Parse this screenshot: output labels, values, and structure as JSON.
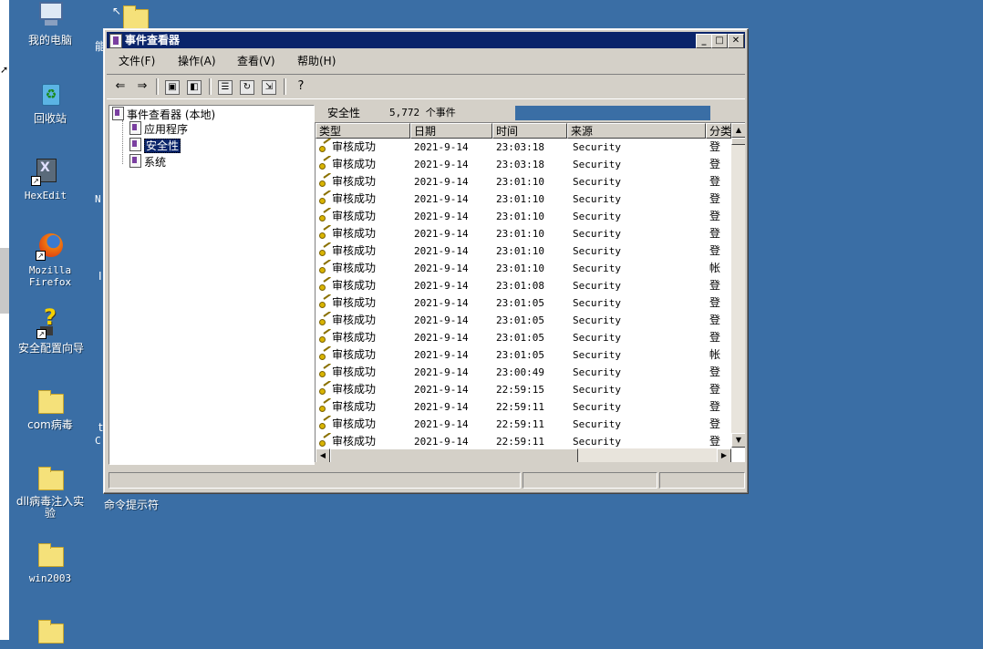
{
  "desktop": {
    "icons": [
      {
        "label": "我的电脑",
        "icon": "my-computer-icon"
      },
      {
        "label": "回收站",
        "icon": "recycle-bin-icon"
      },
      {
        "label": "HexEdit",
        "icon": "hexedit-icon"
      },
      {
        "label": "Mozilla Firefox",
        "icon": "firefox-icon"
      },
      {
        "label": "安全配置向导",
        "icon": "security-wizard-icon"
      },
      {
        "label": "com病毒",
        "icon": "folder-icon"
      },
      {
        "label": "dll病毒注入实验",
        "icon": "folder-icon"
      },
      {
        "label": "win2003",
        "icon": "folder-icon"
      },
      {
        "label": "命令提示符",
        "icon": "cmd-icon"
      }
    ],
    "partial_labels": {
      "a": "能",
      "b": "N",
      "c": "I",
      "d": "t",
      "e": "C"
    }
  },
  "window": {
    "title": "事件查看器",
    "menu": [
      "文件(F)",
      "操作(A)",
      "查看(V)",
      "帮助(H)"
    ],
    "toolbar_icons": [
      "back-arrow-icon",
      "forward-arrow-icon",
      "up-folder-icon",
      "show-hide-tree-icon",
      "properties-icon",
      "refresh-icon",
      "export-list-icon",
      "help-icon"
    ],
    "tree": {
      "root": "事件查看器 (本地)",
      "children": [
        "应用程序",
        "安全性",
        "系统"
      ],
      "selected": "安全性"
    },
    "list": {
      "pane_title": "安全性",
      "event_count": "5,772 个事件",
      "columns": [
        "类型",
        "日期",
        "时间",
        "来源",
        "分类"
      ],
      "rows": [
        {
          "type": "审核成功",
          "date": "2021-9-14",
          "time": "23:03:18",
          "source": "Security",
          "category": "登"
        },
        {
          "type": "审核成功",
          "date": "2021-9-14",
          "time": "23:03:18",
          "source": "Security",
          "category": "登"
        },
        {
          "type": "审核成功",
          "date": "2021-9-14",
          "time": "23:01:10",
          "source": "Security",
          "category": "登"
        },
        {
          "type": "审核成功",
          "date": "2021-9-14",
          "time": "23:01:10",
          "source": "Security",
          "category": "登"
        },
        {
          "type": "审核成功",
          "date": "2021-9-14",
          "time": "23:01:10",
          "source": "Security",
          "category": "登"
        },
        {
          "type": "审核成功",
          "date": "2021-9-14",
          "time": "23:01:10",
          "source": "Security",
          "category": "登"
        },
        {
          "type": "审核成功",
          "date": "2021-9-14",
          "time": "23:01:10",
          "source": "Security",
          "category": "登"
        },
        {
          "type": "审核成功",
          "date": "2021-9-14",
          "time": "23:01:10",
          "source": "Security",
          "category": "帐"
        },
        {
          "type": "审核成功",
          "date": "2021-9-14",
          "time": "23:01:08",
          "source": "Security",
          "category": "登"
        },
        {
          "type": "审核成功",
          "date": "2021-9-14",
          "time": "23:01:05",
          "source": "Security",
          "category": "登"
        },
        {
          "type": "审核成功",
          "date": "2021-9-14",
          "time": "23:01:05",
          "source": "Security",
          "category": "登"
        },
        {
          "type": "审核成功",
          "date": "2021-9-14",
          "time": "23:01:05",
          "source": "Security",
          "category": "登"
        },
        {
          "type": "审核成功",
          "date": "2021-9-14",
          "time": "23:01:05",
          "source": "Security",
          "category": "帐"
        },
        {
          "type": "审核成功",
          "date": "2021-9-14",
          "time": "23:00:49",
          "source": "Security",
          "category": "登"
        },
        {
          "type": "审核成功",
          "date": "2021-9-14",
          "time": "22:59:15",
          "source": "Security",
          "category": "登"
        },
        {
          "type": "审核成功",
          "date": "2021-9-14",
          "time": "22:59:11",
          "source": "Security",
          "category": "登"
        },
        {
          "type": "审核成功",
          "date": "2021-9-14",
          "time": "22:59:11",
          "source": "Security",
          "category": "登"
        },
        {
          "type": "审核成功",
          "date": "2021-9-14",
          "time": "22:59:11",
          "source": "Security",
          "category": "登"
        }
      ]
    }
  },
  "colors": {
    "desktop": "#3a6ea5",
    "titlebar": "#0a246a",
    "window": "#d4d0c8"
  }
}
